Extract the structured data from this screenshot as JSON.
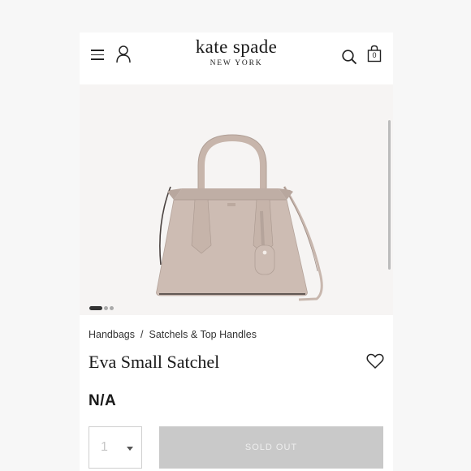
{
  "header": {
    "logo_main": "kate spade",
    "logo_sub": "NEW YORK",
    "bag_count": "0",
    "icons": [
      "menu-icon",
      "account-icon",
      "search-icon",
      "shopping-bag-icon"
    ]
  },
  "gallery": {
    "image_count": 3,
    "active_index": 0
  },
  "product": {
    "breadcrumb": [
      "Handbags",
      "Satchels & Top Handles"
    ],
    "breadcrumb_separator": "/",
    "name": "Eva Small Satchel",
    "price": "N/A",
    "quantity": "1",
    "cta_label": "SOLD OUT"
  },
  "colors": {
    "bag_body": "#cdbcb3",
    "cta_disabled": "#c9c9c9",
    "text": "#1a1a1a"
  }
}
